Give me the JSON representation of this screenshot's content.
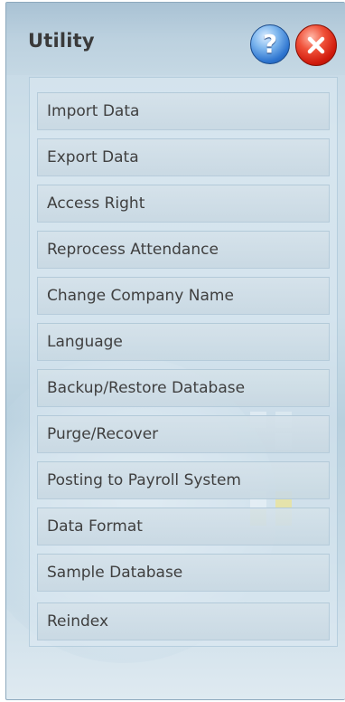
{
  "window": {
    "title": "Utility"
  },
  "controls": {
    "help_glyph": "?",
    "help_icon": "help-icon",
    "close_icon": "close-icon"
  },
  "menu": {
    "items": [
      {
        "label": "Import Data"
      },
      {
        "label": "Export Data"
      },
      {
        "label": "Access Right"
      },
      {
        "label": "Reprocess Attendance"
      },
      {
        "label": "Change Company Name"
      },
      {
        "label": "Language"
      },
      {
        "label": "Backup/Restore Database"
      },
      {
        "label": "Purge/Recover"
      },
      {
        "label": "Posting to Payroll System"
      },
      {
        "label": "Data Format"
      },
      {
        "label": "Sample Database"
      },
      {
        "label": "Reindex"
      }
    ]
  },
  "colors": {
    "panel_bg": "#cbdde8",
    "text": "#3f3f3f",
    "help_blue": "#2d74cf",
    "close_red": "#d01a0c"
  }
}
